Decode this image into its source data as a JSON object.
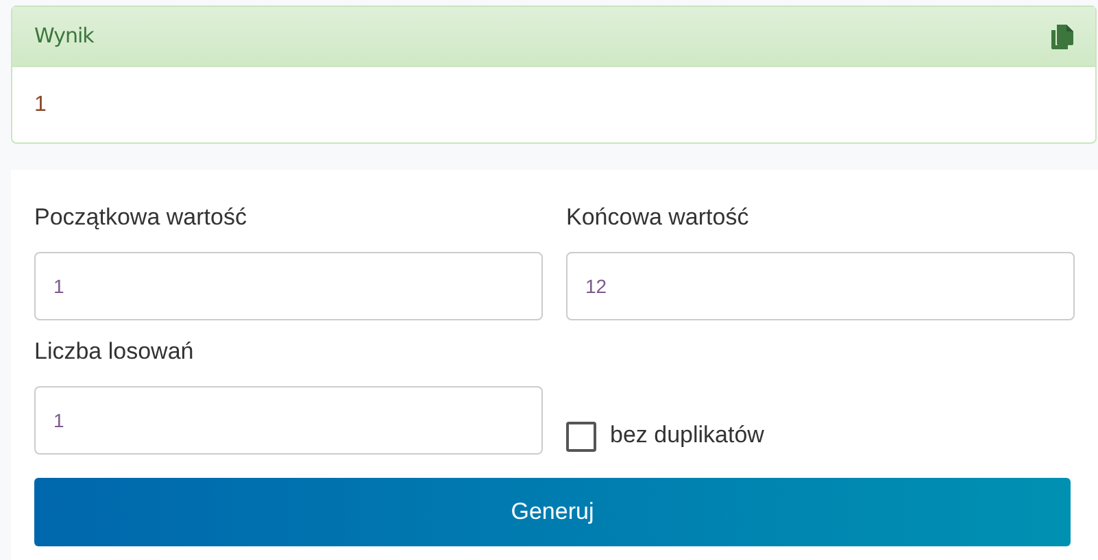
{
  "result": {
    "title": "Wynik",
    "value": "1"
  },
  "fields": [
    {
      "label": "Początkowa wartość",
      "value": "1"
    },
    {
      "label": "Końcowa wartość",
      "value": "12"
    },
    {
      "label": "Liczba losowań",
      "value": "1"
    }
  ],
  "no_duplicates": {
    "label": "bez duplikatów",
    "checked": false
  },
  "button": "Generuj"
}
